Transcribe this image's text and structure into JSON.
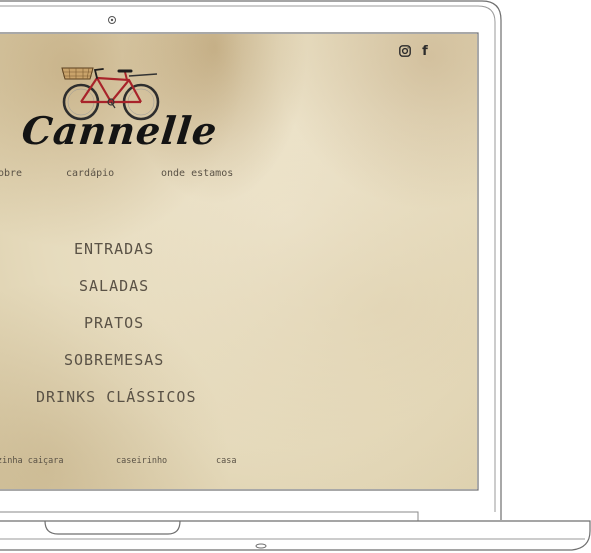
{
  "site": {
    "logo_text": "Cannelle"
  },
  "social": {
    "instagram_icon": "instagram-icon",
    "facebook_glyph": "f"
  },
  "nav": {
    "items": [
      "obre",
      "cardápio",
      "onde estamos"
    ]
  },
  "menu": {
    "categories": [
      "ENTRADAS",
      "SALADAS",
      "PRATOS",
      "SOBREMESAS",
      "DRINKS CLÁSSICOS"
    ]
  },
  "footer": {
    "links": [
      "zinha caiçara",
      "caseirinho",
      "casa"
    ]
  },
  "colors": {
    "text": "#5a5246",
    "logo": "#141414",
    "bike_red": "#a8232a",
    "paper": "#e6dbbd"
  }
}
